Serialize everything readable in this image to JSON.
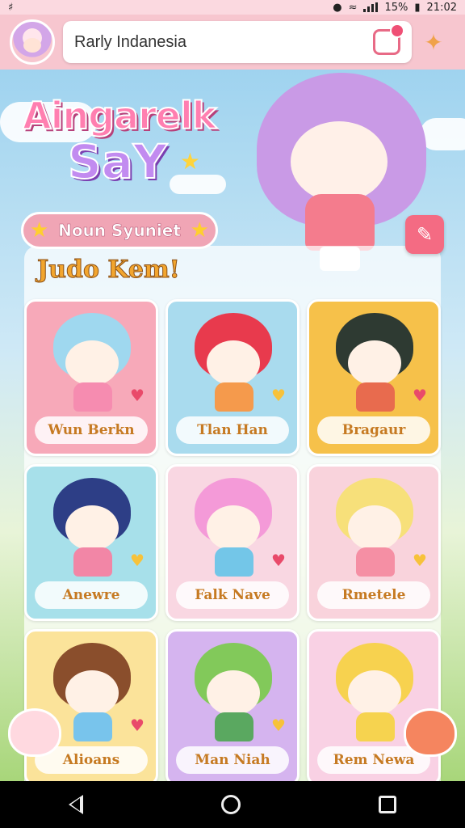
{
  "status": {
    "time": "21:02",
    "battery": "15%"
  },
  "search": {
    "value": "Rarly Indanesia"
  },
  "logo": {
    "line1": "Aingarelk",
    "line2": "SaY"
  },
  "banner": {
    "label": "Noun Syuniet"
  },
  "section": {
    "title": "Judo Kem!"
  },
  "characters": [
    {
      "name": "Wun Berkn",
      "bg": "#f7a9b9",
      "hair": "#9fd8ef",
      "outfit": "#f68cb0"
    },
    {
      "name": "Tlan Han",
      "bg": "#a9dbee",
      "hair": "#e83a4d",
      "outfit": "#f59a4c"
    },
    {
      "name": "Bragaur",
      "bg": "#f6c14a",
      "hair": "#2e3a32",
      "outfit": "#e86b4e"
    },
    {
      "name": "Anewre",
      "bg": "#a7e0ea",
      "hair": "#2d3e86",
      "outfit": "#f286a6"
    },
    {
      "name": "Falk Nave",
      "bg": "#f9d7e2",
      "hair": "#f49ad8",
      "outfit": "#73c6e8"
    },
    {
      "name": "Rmetele",
      "bg": "#f9d3dc",
      "hair": "#f7e07a",
      "outfit": "#f58fa4"
    },
    {
      "name": "Alioans",
      "bg": "#fbe39a",
      "hair": "#8a4e2c",
      "outfit": "#78c4ec"
    },
    {
      "name": "Man Niah",
      "bg": "#d5b4ef",
      "hair": "#82c95a",
      "outfit": "#5aa860"
    },
    {
      "name": "Rem Newa",
      "bg": "#f9d1e4",
      "hair": "#f7d24f",
      "outfit": "#f6d34f"
    }
  ]
}
